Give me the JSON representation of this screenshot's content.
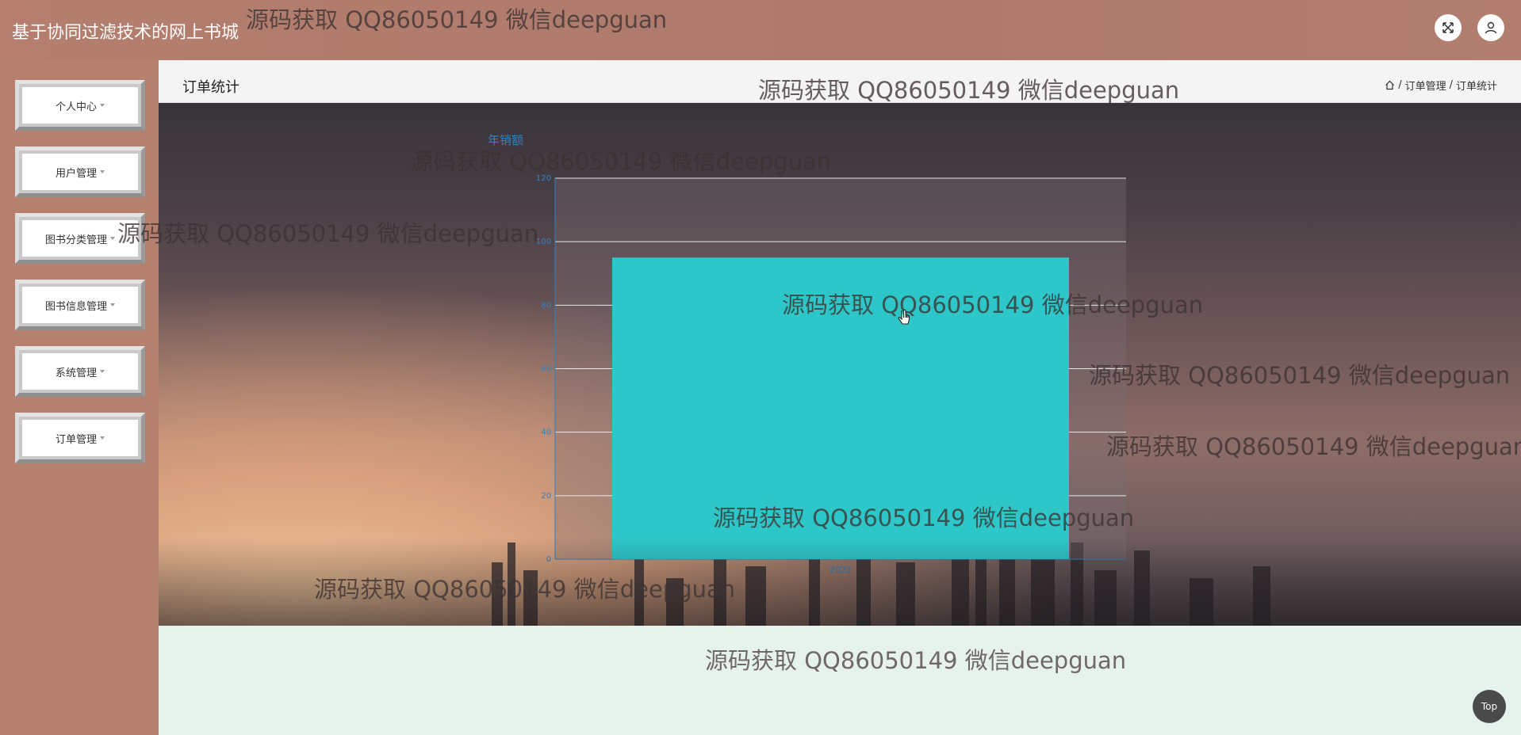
{
  "app": {
    "title": "基于协同过滤技术的网上书城"
  },
  "header": {
    "fullscreen_icon": "expand-icon",
    "user_icon": "user-icon"
  },
  "sidebar": {
    "items": [
      {
        "label": "个人中心"
      },
      {
        "label": "用户管理"
      },
      {
        "label": "图书分类管理"
      },
      {
        "label": "图书信息管理"
      },
      {
        "label": "系统管理"
      },
      {
        "label": "订单管理"
      }
    ]
  },
  "page": {
    "title": "订单统计",
    "breadcrumb": [
      "订单管理",
      "订单统计"
    ],
    "breadcrumb_separator": "/"
  },
  "chart_data": {
    "type": "bar",
    "title": "年销额",
    "categories": [
      "2022"
    ],
    "values": [
      95
    ],
    "yticks": [
      0,
      20,
      40,
      60,
      80,
      100,
      120
    ],
    "ylim": [
      0,
      120
    ],
    "grid": true,
    "colors": {
      "bar": "#2ec7c9",
      "axis": "#2a84c6"
    }
  },
  "watermark": "源码获取 QQ86050149 微信deepguan",
  "top_button": {
    "label": "Top"
  }
}
